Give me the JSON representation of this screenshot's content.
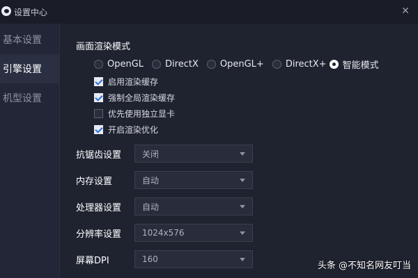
{
  "window": {
    "title": "设置中心",
    "close_glyph": "✕"
  },
  "sidebar": {
    "items": [
      {
        "label": "基本设置",
        "active": false
      },
      {
        "label": "引擎设置",
        "active": true
      },
      {
        "label": "机型设置",
        "active": false
      }
    ]
  },
  "render": {
    "section_title": "画面渲染模式",
    "modes": [
      {
        "label": "OpenGL",
        "checked": false
      },
      {
        "label": "DirectX",
        "checked": false
      },
      {
        "label": "OpenGL+",
        "checked": false
      },
      {
        "label": "DirectX+",
        "checked": false
      },
      {
        "label": "智能模式",
        "checked": true
      }
    ],
    "options": [
      {
        "label": "启用渲染缓存",
        "checked": true
      },
      {
        "label": "强制全局渲染缓存",
        "checked": true
      },
      {
        "label": "优先使用独立显卡",
        "checked": false
      },
      {
        "label": "开启渲染优化",
        "checked": true
      }
    ]
  },
  "settings": {
    "antialias": {
      "label": "抗锯齿设置",
      "value": "关闭"
    },
    "memory": {
      "label": "内存设置",
      "value": "自动"
    },
    "cpu": {
      "label": "处理器设置",
      "value": "自动"
    },
    "resolution": {
      "label": "分辨率设置",
      "value": "1024x576"
    },
    "dpi": {
      "label": "屏幕DPI",
      "value": "160"
    }
  },
  "watermark": "头条 @不知名网友叮当",
  "icons": [
    "app-logo-icon",
    "close-icon",
    "chevron-down-icon",
    "checkmark-icon"
  ]
}
